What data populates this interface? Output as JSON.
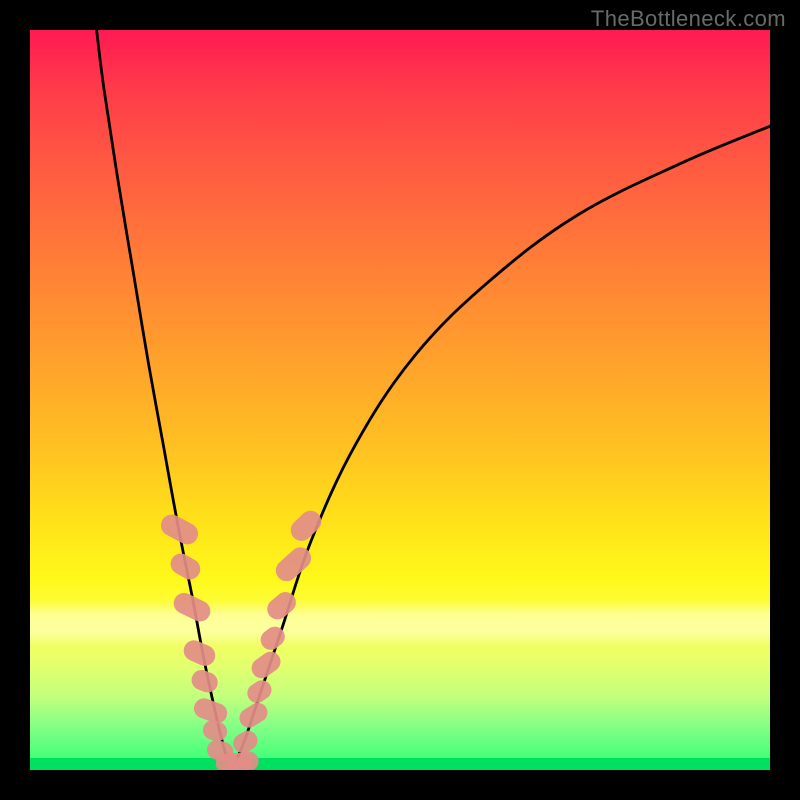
{
  "watermark": "TheBottleneck.com",
  "colors": {
    "marker_fill": "#e38d88",
    "curve_stroke": "#000000",
    "background": "#000000"
  },
  "chart_data": {
    "type": "line",
    "title": "",
    "xlabel": "",
    "ylabel": "",
    "xlim": [
      0,
      100
    ],
    "ylim": [
      0,
      100
    ],
    "grid": false,
    "legend": false,
    "note": "Values are approximate percentages of the plot area; curve minimum near x≈26–28 touching y≈0.",
    "series": [
      {
        "name": "left-branch",
        "x": [
          9,
          10,
          12,
          14,
          16,
          18,
          20,
          22,
          23.5,
          25,
          26.2,
          27
        ],
        "y": [
          100,
          92,
          79,
          67,
          55,
          44,
          33,
          23,
          15,
          8,
          3,
          0.5
        ]
      },
      {
        "name": "right-branch",
        "x": [
          27.5,
          29,
          31,
          34,
          38,
          44,
          52,
          62,
          74,
          88,
          100
        ],
        "y": [
          0.5,
          4,
          10,
          19,
          31,
          44,
          56,
          66,
          75,
          82,
          87
        ]
      }
    ],
    "markers": {
      "name": "highlighted-points",
      "shape": "rounded-rect",
      "note": "Salmon-colored capsule markers clustered along both branches in the lower 35% of the plot.",
      "points": [
        {
          "x": 20.2,
          "y": 32.5,
          "w": 2.9,
          "h": 5.3,
          "rot": -62
        },
        {
          "x": 21.0,
          "y": 27.5,
          "w": 2.8,
          "h": 4.2,
          "rot": -60
        },
        {
          "x": 21.9,
          "y": 22.0,
          "w": 2.8,
          "h": 5.2,
          "rot": -64
        },
        {
          "x": 22.9,
          "y": 15.8,
          "w": 2.8,
          "h": 4.4,
          "rot": -66
        },
        {
          "x": 23.6,
          "y": 12.0,
          "w": 2.7,
          "h": 3.6,
          "rot": -68
        },
        {
          "x": 24.4,
          "y": 8.0,
          "w": 2.7,
          "h": 4.6,
          "rot": -70
        },
        {
          "x": 25.0,
          "y": 5.3,
          "w": 2.6,
          "h": 3.3,
          "rot": -72
        },
        {
          "x": 25.7,
          "y": 2.6,
          "w": 2.6,
          "h": 3.6,
          "rot": -74
        },
        {
          "x": 26.7,
          "y": 0.9,
          "w": 3.2,
          "h": 2.6,
          "rot": 0
        },
        {
          "x": 28.2,
          "y": 1.0,
          "w": 3.6,
          "h": 2.6,
          "rot": 0
        },
        {
          "x": 29.5,
          "y": 1.2,
          "w": 2.8,
          "h": 2.6,
          "rot": 0
        },
        {
          "x": 29.1,
          "y": 3.8,
          "w": 2.6,
          "h": 3.4,
          "rot": 60
        },
        {
          "x": 30.2,
          "y": 7.4,
          "w": 2.6,
          "h": 4.0,
          "rot": 58
        },
        {
          "x": 31.0,
          "y": 10.6,
          "w": 2.6,
          "h": 3.4,
          "rot": 56
        },
        {
          "x": 31.9,
          "y": 14.2,
          "w": 2.7,
          "h": 4.2,
          "rot": 54
        },
        {
          "x": 32.8,
          "y": 17.8,
          "w": 2.7,
          "h": 3.4,
          "rot": 52
        },
        {
          "x": 34.0,
          "y": 22.2,
          "w": 2.8,
          "h": 4.2,
          "rot": 50
        },
        {
          "x": 35.6,
          "y": 27.8,
          "w": 2.9,
          "h": 5.4,
          "rot": 48
        },
        {
          "x": 37.3,
          "y": 33.0,
          "w": 2.9,
          "h": 4.6,
          "rot": 46
        }
      ]
    }
  }
}
